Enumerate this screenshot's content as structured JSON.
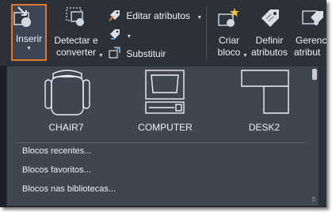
{
  "ribbon": {
    "insert_label": "Inserir",
    "detect_label_1": "Detectar e",
    "detect_label_2": "converter",
    "edit_attrs_label": "Editar atributos",
    "substitute_label": "Substituir",
    "create_label_1": "Criar",
    "create_label_2": "bloco",
    "define_label_1": "Definir",
    "define_label_2": "atributos",
    "manage_label_1": "Gerenci",
    "manage_label_2": "atribut"
  },
  "gallery": {
    "blocks": [
      {
        "name": "CHAIR7",
        "icon": "chair-icon"
      },
      {
        "name": "COMPUTER",
        "icon": "computer-icon"
      },
      {
        "name": "DESK2",
        "icon": "desk-icon"
      }
    ]
  },
  "menu": {
    "recent": "Blocos recentes...",
    "favorites": "Blocos favoritos...",
    "libraries": "Blocos nas bibliotecas..."
  },
  "colors": {
    "accent": "#e3772a",
    "panel": "#3f4651",
    "ribbon": "#2c3038"
  }
}
